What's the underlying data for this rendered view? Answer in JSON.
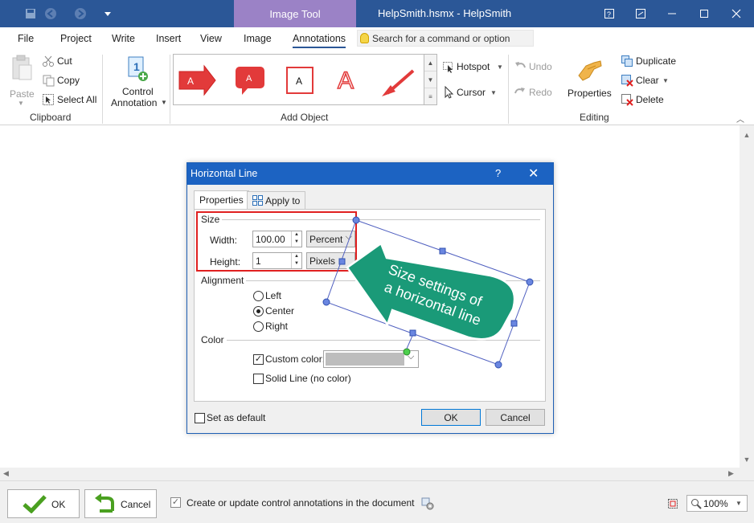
{
  "window": {
    "context_tab": "Image Tool",
    "title": "HelpSmith.hsmx - HelpSmith"
  },
  "menu": {
    "tabs": [
      "File",
      "Project",
      "Write",
      "Insert",
      "View",
      "Image",
      "Annotations"
    ],
    "search_placeholder": "Search for a command or option"
  },
  "ribbon": {
    "clipboard": {
      "paste": "Paste",
      "cut": "Cut",
      "copy": "Copy",
      "select_all": "Select All",
      "group": "Clipboard"
    },
    "control_annotation": {
      "line1": "Control",
      "line2": "Annotation"
    },
    "add_object": {
      "group": "Add Object",
      "gallery_letter": "A",
      "hotspot": "Hotspot",
      "cursor": "Cursor"
    },
    "editing": {
      "undo": "Undo",
      "redo": "Redo",
      "properties": "Properties",
      "duplicate": "Duplicate",
      "clear": "Clear",
      "delete": "Delete",
      "group": "Editing"
    }
  },
  "dialog": {
    "title": "Horizontal Line",
    "help": "?",
    "tabs": {
      "properties": "Properties",
      "apply_to": "Apply to"
    },
    "size": {
      "title": "Size",
      "width_label": "Width:",
      "width_value": "100.00",
      "width_unit": "Percent",
      "height_label": "Height:",
      "height_value": "1",
      "height_unit": "Pixels"
    },
    "alignment": {
      "title": "Alignment",
      "options": [
        "Left",
        "Center",
        "Right"
      ],
      "selected": "Center"
    },
    "color": {
      "title": "Color",
      "custom_color": "Custom color:",
      "custom_checked": true,
      "solid_line": "Solid Line (no color)",
      "swatch": "#bdbdbd"
    },
    "set_default": "Set as default",
    "ok": "OK",
    "cancel": "Cancel"
  },
  "callout": {
    "line1": "Size settings of",
    "line2": "a horizontal line"
  },
  "bottom": {
    "ok": "OK",
    "cancel": "Cancel",
    "create_update": "Create or update control annotations in the document",
    "zoom": "100%"
  },
  "colors": {
    "titlebar": "#2b5797",
    "context_tab": "#9b82c6",
    "dialog_title": "#1c63c2",
    "callout": "#1a9a78",
    "highlight": "#e02020"
  }
}
